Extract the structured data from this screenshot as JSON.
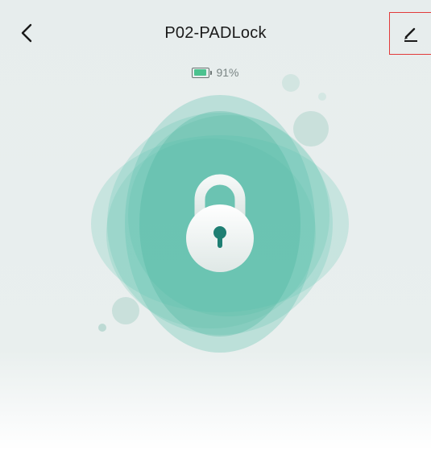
{
  "header": {
    "title": "P02-PADLock",
    "back_icon": "chevron-left-icon",
    "edit_icon": "pencil-icon"
  },
  "battery": {
    "level_text": "91%",
    "level": 0.91,
    "icon": "battery-icon",
    "fill_color": "#4cc28f"
  },
  "lock": {
    "icon": "padlock-icon",
    "state": "locked",
    "accent_color": "#3bb39a"
  },
  "highlight_color": "#e23a3a"
}
